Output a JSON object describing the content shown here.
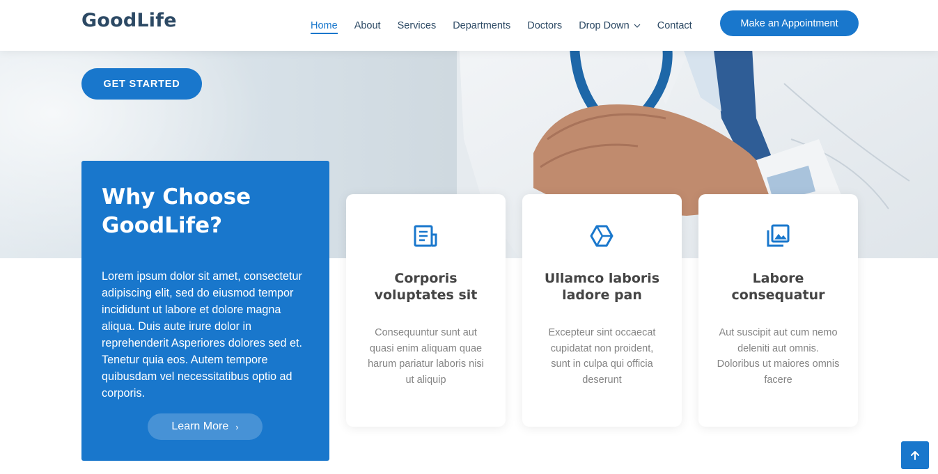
{
  "header": {
    "logo": "GoodLife",
    "nav": [
      {
        "label": "Home",
        "active": true
      },
      {
        "label": "About"
      },
      {
        "label": "Services"
      },
      {
        "label": "Departments"
      },
      {
        "label": "Doctors"
      },
      {
        "label": "Drop Down"
      },
      {
        "label": "Contact"
      }
    ],
    "appointment_label": "Make an Appointment"
  },
  "hero": {
    "get_started_label": "GET STARTED"
  },
  "why": {
    "title": "Why Choose GoodLife?",
    "text": "Lorem ipsum dolor sit amet, consectetur adipiscing elit, sed do eiusmod tempor incididunt ut labore et dolore magna aliqua. Duis aute irure dolor in reprehenderit Asperiores dolores sed et. Tenetur quia eos. Autem tempore quibusdam vel necessitatibus optio ad corporis.",
    "learn_more_label": "Learn More"
  },
  "cards": [
    {
      "icon": "document-icon",
      "title": "Corporis voluptates sit",
      "text": "Consequuntur sunt aut quasi enim aliquam quae harum pariatur laboris nisi ut aliquip"
    },
    {
      "icon": "cube-icon",
      "title": "Ullamco laboris ladore pan",
      "text": "Excepteur sint occaecat cupidatat non proident, sunt in culpa qui officia deserunt"
    },
    {
      "icon": "images-icon",
      "title": "Labore consequatur",
      "text": "Aut suscipit aut cum nemo deleniti aut omnis. Doloribus ut maiores omnis facere"
    }
  ],
  "colors": {
    "accent": "#1977cc",
    "heading": "#2c4964"
  }
}
